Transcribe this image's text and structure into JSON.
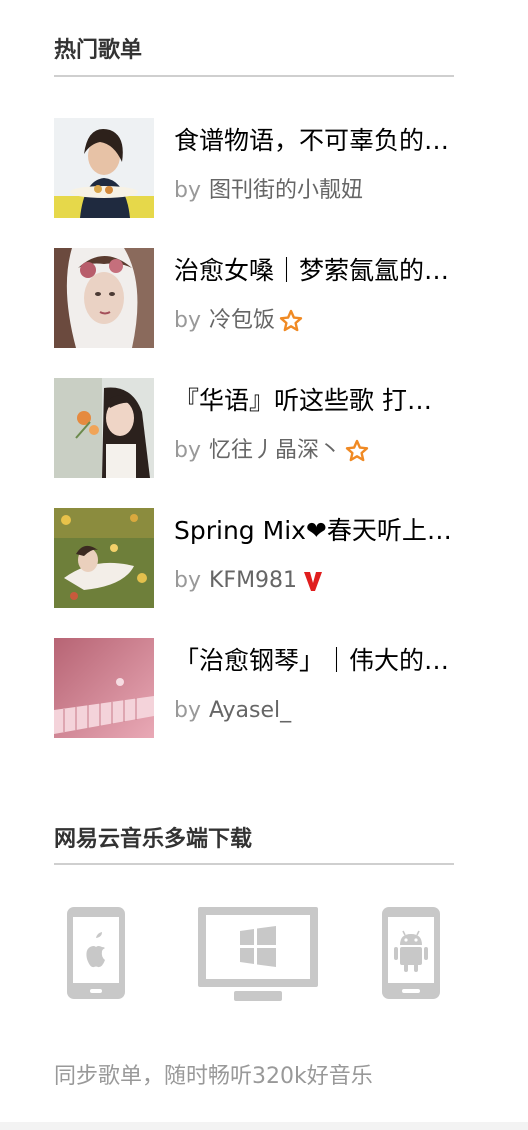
{
  "hot_playlists": {
    "title": "热门歌单",
    "by_prefix": "by",
    "items": [
      {
        "name": "食谱物语，不可辜负的美食与音乐",
        "author": "图刊街的小靓妞",
        "badge": "",
        "cover_icon": "woman-holding-plate-photo"
      },
      {
        "name": "治愈女嗓｜梦萦氤氲的温柔女声",
        "author": "冷包饭",
        "badge": "star-icon",
        "cover_icon": "woman-with-flowers-photo"
      },
      {
        "name": "『华语』听这些歌 打动你的心",
        "author": "忆往丿晶深丶",
        "badge": "star-icon",
        "cover_icon": "girl-with-flowers-photo"
      },
      {
        "name": "Spring Mix❤春天听上一首歌",
        "author": "KFM981",
        "badge": "v-icon",
        "cover_icon": "girl-lying-in-grass-photo"
      },
      {
        "name": "「治愈钢琴」｜伟大的钢琴曲",
        "author": "Ayasel_",
        "badge": "",
        "cover_icon": "pink-piano-photo"
      }
    ]
  },
  "downloads": {
    "title": "网易云音乐多端下载",
    "tagline": "同步歌单，随时畅听320k好音乐",
    "platforms": [
      {
        "icon": "iphone-icon"
      },
      {
        "icon": "windows-pc-icon"
      },
      {
        "icon": "android-phone-icon"
      }
    ]
  },
  "colors": {
    "title": "#333333",
    "divider": "#cfcfcf",
    "muted": "#999999",
    "author": "#666666",
    "star_badge": "#f08a24",
    "v_badge": "#e01e1e",
    "device_icon": "#c8c8c8"
  }
}
